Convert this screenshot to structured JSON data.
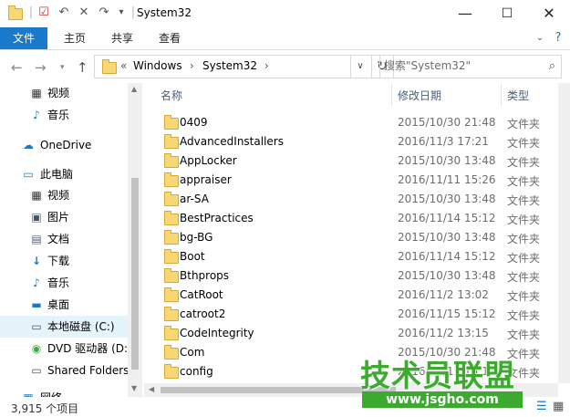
{
  "window": {
    "title": "System32"
  },
  "ribbon": {
    "tabs": [
      "文件",
      "主页",
      "共享",
      "查看"
    ]
  },
  "address": {
    "overflow": "«",
    "crumbs": [
      "Windows",
      "System32"
    ]
  },
  "search": {
    "placeholder": "搜索\"System32\""
  },
  "nav_pane": {
    "items": [
      {
        "label": "视频",
        "icon": "video-icon",
        "level": 1
      },
      {
        "label": "音乐",
        "icon": "music-icon",
        "level": 1
      },
      {
        "label": "OneDrive",
        "icon": "cloud-icon",
        "level": 0
      },
      {
        "label": "此电脑",
        "icon": "computer-icon",
        "level": 0
      },
      {
        "label": "视频",
        "icon": "video-icon",
        "level": 1
      },
      {
        "label": "图片",
        "icon": "pictures-icon",
        "level": 1
      },
      {
        "label": "文档",
        "icon": "documents-icon",
        "level": 1
      },
      {
        "label": "下载",
        "icon": "download-icon",
        "level": 1
      },
      {
        "label": "音乐",
        "icon": "music-icon",
        "level": 1
      },
      {
        "label": "桌面",
        "icon": "desktop-icon",
        "level": 1
      },
      {
        "label": "本地磁盘 (C:)",
        "icon": "drive-icon",
        "level": 1,
        "selected": true
      },
      {
        "label": "DVD 驱动器 (D:",
        "icon": "dvd-icon",
        "level": 1
      },
      {
        "label": "Shared Folders",
        "icon": "network-drive-icon",
        "level": 1
      },
      {
        "label": "网络",
        "icon": "network-icon",
        "level": 0
      }
    ]
  },
  "file_list": {
    "columns": {
      "name": "名称",
      "date": "修改日期",
      "type": "类型"
    },
    "rows": [
      {
        "name": "0409",
        "date": "2015/10/30 21:48",
        "type": "文件夹"
      },
      {
        "name": "AdvancedInstallers",
        "date": "2016/11/3 17:21",
        "type": "文件夹"
      },
      {
        "name": "AppLocker",
        "date": "2015/10/30 13:48",
        "type": "文件夹"
      },
      {
        "name": "appraiser",
        "date": "2016/11/11 15:26",
        "type": "文件夹"
      },
      {
        "name": "ar-SA",
        "date": "2015/10/30 13:48",
        "type": "文件夹"
      },
      {
        "name": "BestPractices",
        "date": "2016/11/14 15:12",
        "type": "文件夹"
      },
      {
        "name": "bg-BG",
        "date": "2015/10/30 13:48",
        "type": "文件夹"
      },
      {
        "name": "Boot",
        "date": "2016/11/14 15:12",
        "type": "文件夹"
      },
      {
        "name": "Bthprops",
        "date": "2015/10/30 13:48",
        "type": "文件夹"
      },
      {
        "name": "CatRoot",
        "date": "2016/11/2 13:02",
        "type": "文件夹"
      },
      {
        "name": "catroot2",
        "date": "2016/11/15 15:12",
        "type": "文件夹"
      },
      {
        "name": "CodeIntegrity",
        "date": "2016/11/2 13:15",
        "type": "文件夹"
      },
      {
        "name": "Com",
        "date": "2015/10/30 21:48",
        "type": "文件夹"
      },
      {
        "name": "config",
        "date": "2016/11/15 15:12",
        "type": "文件夹"
      }
    ]
  },
  "status": {
    "item_count": "3,915 个项目"
  },
  "watermark": {
    "title": "技术员联盟",
    "url": "www.jsgho.com"
  },
  "colors": {
    "accent": "#1979ca",
    "selection": "#e5f3fb",
    "folder": "#f8d775",
    "watermark": "#3caa2f"
  }
}
